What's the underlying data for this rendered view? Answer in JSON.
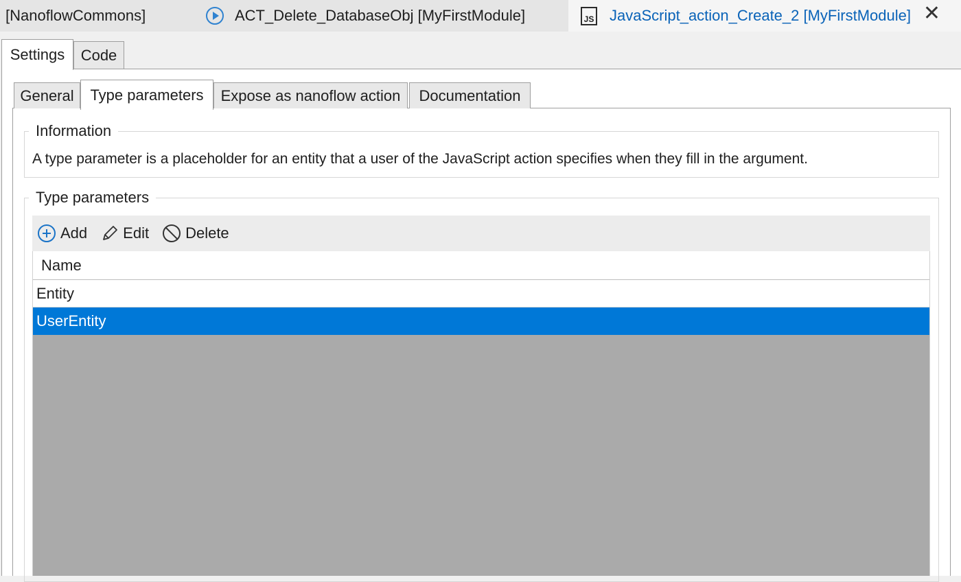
{
  "doc_tabs": [
    {
      "label": "[NanoflowCommons]",
      "icon": "none",
      "active": false
    },
    {
      "label": "ACT_Delete_DatabaseObj [MyFirstModule]",
      "icon": "play-circle-icon",
      "active": false
    },
    {
      "label": "JavaScript_action_Create_2 [MyFirstModule]",
      "icon": "js-icon",
      "active": true
    }
  ],
  "js_icon_text": "JS",
  "close_glyph": "✕",
  "outer_tabs": [
    "Settings",
    "Code"
  ],
  "inner_tabs": [
    "General",
    "Type parameters",
    "Expose as nanoflow action",
    "Documentation"
  ],
  "information": {
    "legend": "Information",
    "text": "A type parameter is a placeholder for an entity that a user of the JavaScript action specifies when they fill in the argument."
  },
  "type_parameters": {
    "legend": "Type parameters",
    "toolbar": {
      "add_label": "Add",
      "edit_label": "Edit",
      "delete_label": "Delete"
    },
    "column_header": "Name",
    "rows": [
      "Entity",
      "UserEntity"
    ],
    "selected_row": "UserEntity"
  },
  "colors": {
    "accent": "#0078d7",
    "active_tab_text": "#0a63b8",
    "empty_grid": "#aaaaaa"
  }
}
